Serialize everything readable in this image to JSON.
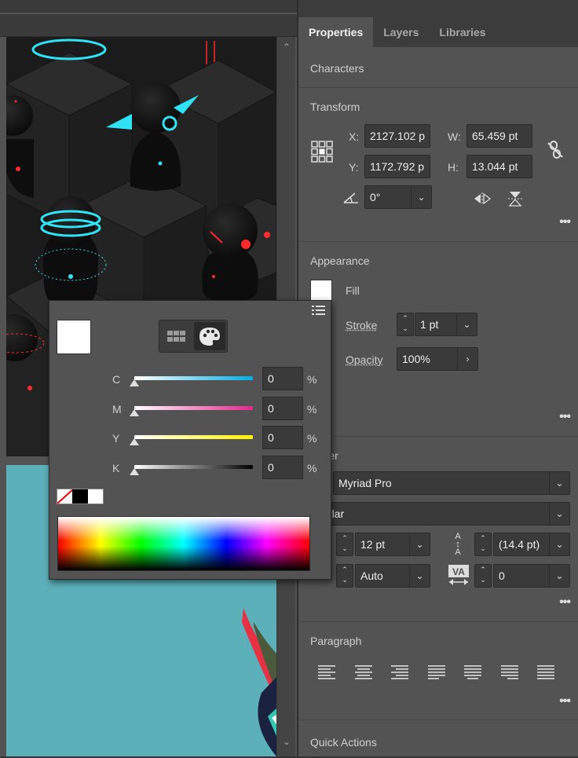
{
  "tabs": [
    "Properties",
    "Layers",
    "Libraries"
  ],
  "sections": {
    "characters": "Characters",
    "transform": "Transform",
    "appearance": "Appearance",
    "character": "Character",
    "paragraph": "Paragraph",
    "quick_actions": "Quick Actions"
  },
  "transform": {
    "x_label": "X:",
    "x_value": "2127.102 p",
    "y_label": "Y:",
    "y_value": "1172.792 p",
    "w_label": "W:",
    "w_value": "65.459 pt",
    "h_label": "H:",
    "h_value": "13.044 pt",
    "rotate_value": "0°"
  },
  "appearance": {
    "fill_label": "Fill",
    "stroke_label": "Stroke",
    "stroke_value": "1 pt",
    "opacity_label": "Opacity",
    "opacity_value": "100%"
  },
  "character": {
    "title_visible": "racter",
    "font_family": "Myriad Pro",
    "font_style_visible": "gular",
    "font_size": "12 pt",
    "leading": "(14.4 pt)",
    "kerning": "Auto",
    "tracking": "0"
  },
  "color_popup": {
    "sliders": [
      {
        "label": "C",
        "value": "0",
        "unit": "%",
        "gradient": "#00aee8"
      },
      {
        "label": "M",
        "value": "0",
        "unit": "%",
        "gradient": "#e8248c"
      },
      {
        "label": "Y",
        "value": "0",
        "unit": "%",
        "gradient": "#fff100"
      },
      {
        "label": "K",
        "value": "0",
        "unit": "%",
        "gradient": "#000000"
      }
    ]
  },
  "colors": {
    "panel_bg": "#535353",
    "field_bg": "#3a3a3a",
    "artboard_teal": "#5cb0ba",
    "neon_cyan": "#2fe3f5",
    "neon_red": "#ff2a2a"
  }
}
